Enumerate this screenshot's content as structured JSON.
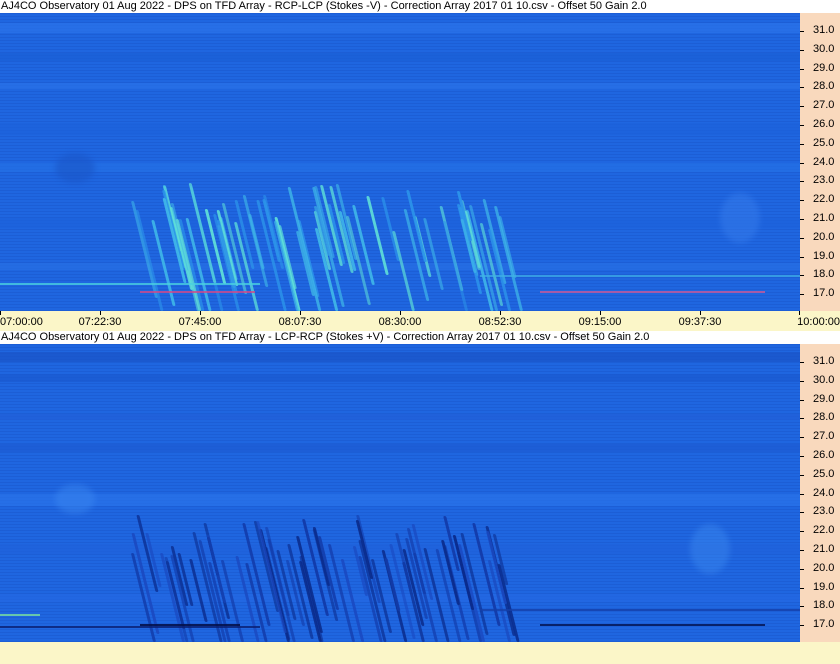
{
  "panels": [
    {
      "title": "AJ4CO Observatory 01 Aug 2022  -  DPS on TFD Array  -  RCP-LCP (Stokes -V)  -  Correction Array 2017 01 10.csv  -  Offset 50  Gain 2.0",
      "y_labels": [
        "31.0",
        "30.0",
        "29.0",
        "28.0",
        "27.0",
        "26.0",
        "25.0",
        "24.0",
        "23.0",
        "22.0",
        "21.0",
        "20.0",
        "19.0",
        "18.0",
        "17.0"
      ],
      "mode": "bright"
    },
    {
      "title": "AJ4CO Observatory 01 Aug 2022  -  DPS on TFD Array  -  LCP-RCP (Stokes +V)  -  Correction Array 2017 01 10.csv  -  Offset 50  Gain 2.0",
      "y_labels": [
        "31.0",
        "30.0",
        "29.0",
        "28.0",
        "27.0",
        "26.0",
        "25.0",
        "24.0",
        "23.0",
        "22.0",
        "21.0",
        "20.0",
        "19.0",
        "18.0",
        "17.0"
      ],
      "mode": "dark"
    }
  ],
  "time_axis": {
    "labels": [
      "07:00:00",
      "07:22:30",
      "07:45:00",
      "08:07:30",
      "08:30:00",
      "08:52:30",
      "09:15:00",
      "09:37:30",
      "10:00:00"
    ]
  },
  "colors": {
    "background": "#1f66e0",
    "y_axis_bg": "#f9d9bd",
    "x_axis_bg": "#fbf6c8"
  }
}
